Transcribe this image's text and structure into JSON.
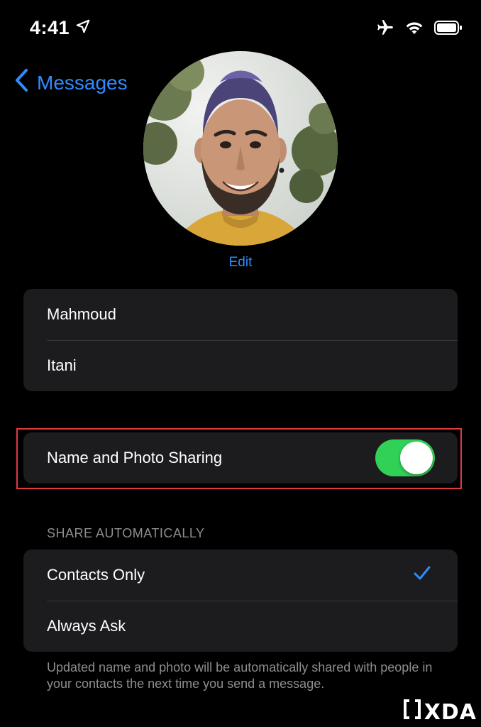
{
  "status_bar": {
    "time": "4:41",
    "location_icon": "location-arrow-icon",
    "airplane_icon": "airplane-icon",
    "wifi_icon": "wifi-icon",
    "battery_icon": "battery-icon"
  },
  "nav": {
    "back_label": "Messages",
    "back_icon": "chevron-left-icon"
  },
  "profile": {
    "edit_label": "Edit"
  },
  "name_fields": {
    "first_name": "Mahmoud",
    "last_name": "Itani"
  },
  "sharing": {
    "label": "Name and Photo Sharing",
    "enabled": true
  },
  "share_automatically": {
    "header": "SHARE AUTOMATICALLY",
    "options": [
      {
        "label": "Contacts Only",
        "selected": true
      },
      {
        "label": "Always Ask",
        "selected": false
      }
    ],
    "footer": "Updated name and photo will be automatically shared with people in your contacts the next time you send a message."
  },
  "watermark": {
    "brand": "XDA"
  },
  "colors": {
    "accent": "#2f8cff",
    "toggle_on": "#31d158",
    "highlight": "#e0393e",
    "background": "#000000",
    "cell_background": "#1c1c1e"
  }
}
